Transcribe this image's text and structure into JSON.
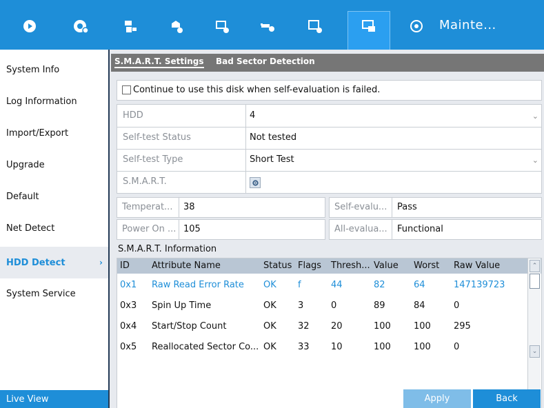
{
  "topbar": {
    "title": "Mainte...",
    "icons": [
      "live-view-icon",
      "playback-icon",
      "camera-icon",
      "record-icon",
      "storage-icon",
      "network-icon",
      "system-config-icon",
      "maintenance-icon",
      "info-icon"
    ]
  },
  "sidebar": {
    "items": [
      {
        "label": "System Info"
      },
      {
        "label": "Log Information"
      },
      {
        "label": "Import/Export"
      },
      {
        "label": "Upgrade"
      },
      {
        "label": "Default"
      },
      {
        "label": "Net Detect"
      },
      {
        "label": "HDD Detect",
        "chevron": "›"
      },
      {
        "label": "System Service"
      }
    ],
    "live_view": "Live View"
  },
  "tabs": [
    {
      "label": "S.M.A.R.T. Settings"
    },
    {
      "label": "Bad Sector Detection"
    }
  ],
  "form": {
    "continue_label": "Continue to use this disk when self-evaluation is failed.",
    "hdd_label": "HDD",
    "hdd_value": "4",
    "selftest_status_label": "Self-test Status",
    "selftest_status_value": "Not tested",
    "selftest_type_label": "Self-test Type",
    "selftest_type_value": "Short Test",
    "smart_label": "S.M.A.R.T.",
    "temperature_label": "Temperat...",
    "temperature_value": "38",
    "self_eval_label": "Self-evalu...",
    "self_eval_value": "Pass",
    "power_on_label": "Power On ...",
    "power_on_value": "105",
    "all_eval_label": "All-evalua...",
    "all_eval_value": "Functional"
  },
  "smart_info": {
    "title": "S.M.A.R.T. Information",
    "columns": [
      "ID",
      "Attribute Name",
      "Status",
      "Flags",
      "Thresh...",
      "Value",
      "Worst",
      "Raw Value"
    ],
    "rows": [
      [
        "0x1",
        "Raw Read Error Rate",
        "OK",
        "f",
        "44",
        "82",
        "64",
        "147139723"
      ],
      [
        "0x3",
        "Spin Up Time",
        "OK",
        "3",
        "0",
        "89",
        "84",
        "0"
      ],
      [
        "0x4",
        "Start/Stop Count",
        "OK",
        "32",
        "20",
        "100",
        "100",
        "295"
      ],
      [
        "0x5",
        "Reallocated Sector Co...",
        "OK",
        "33",
        "10",
        "100",
        "100",
        "0"
      ]
    ]
  },
  "buttons": {
    "apply": "Apply",
    "back": "Back"
  },
  "colors": {
    "accent": "#1e8ed8",
    "apply_disabled": "#7fbde8"
  }
}
